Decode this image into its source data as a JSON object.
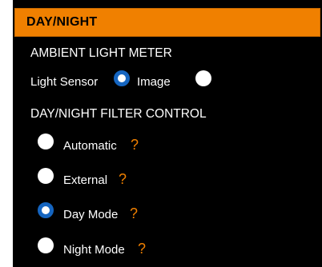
{
  "panel": {
    "title": "DAY/NIGHT",
    "accent_color": "#f08000",
    "checked_color": "#1565c0"
  },
  "ambient_light_meter": {
    "title": "AMBIENT LIGHT METER",
    "options": [
      {
        "label": "Light Sensor",
        "selected": true
      },
      {
        "label": "Image",
        "selected": false
      }
    ]
  },
  "filter_control": {
    "title": "DAY/NIGHT FILTER CONTROL",
    "help_glyph": "?",
    "options": [
      {
        "label": "Automatic",
        "selected": false
      },
      {
        "label": "External",
        "selected": false
      },
      {
        "label": "Day Mode",
        "selected": true
      },
      {
        "label": "Night Mode",
        "selected": false
      }
    ]
  }
}
